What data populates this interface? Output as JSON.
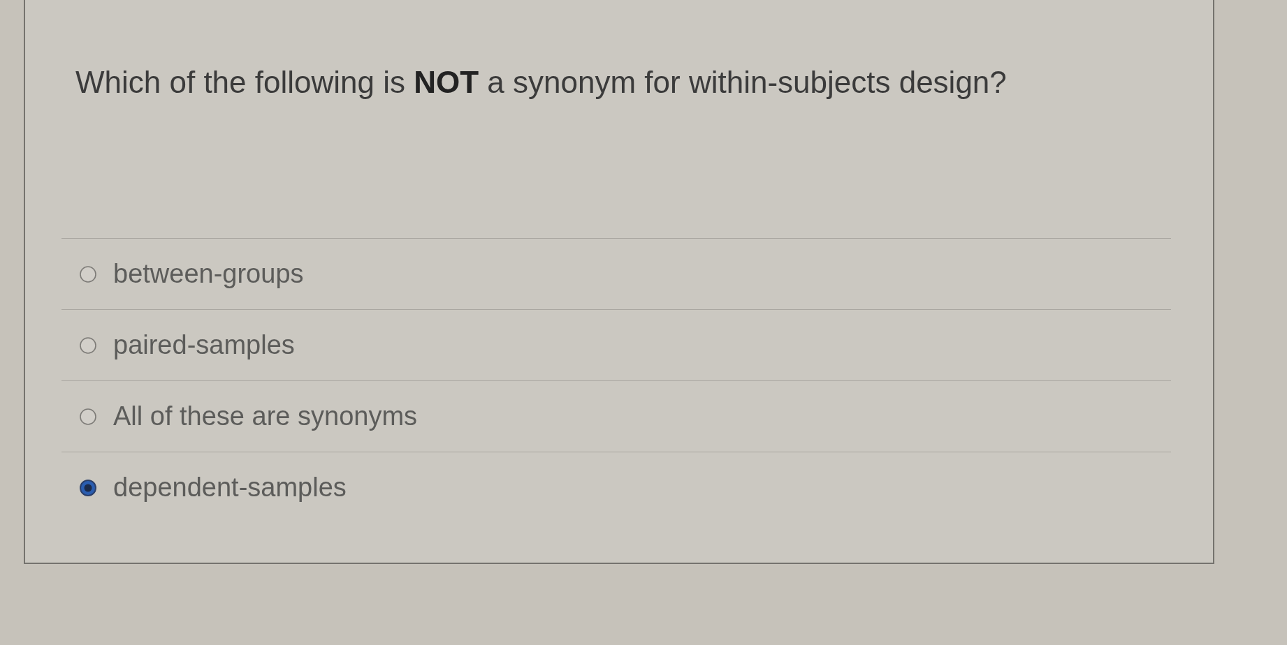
{
  "question": {
    "text": "Which of the following is **NOT** a synonym for within-subjects design?"
  },
  "options": [
    {
      "label": "between-groups",
      "selected": false
    },
    {
      "label": "paired-samples",
      "selected": false
    },
    {
      "label": "All of these are synonyms",
      "selected": false
    },
    {
      "label": "dependent-samples",
      "selected": true
    }
  ]
}
